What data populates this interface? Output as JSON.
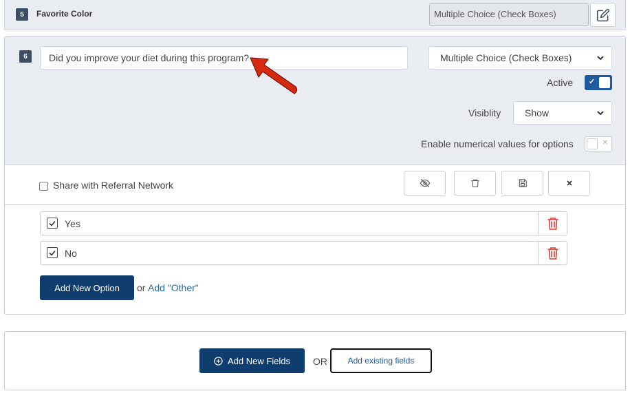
{
  "field5": {
    "number": "5",
    "title": "Favorite Color",
    "type_value": "Multiple Choice (Check Boxes)"
  },
  "field6": {
    "number": "6",
    "question_value": "Did you improve your diet during this program?",
    "type_value": "Multiple Choice (Check Boxes)",
    "active_label": "Active",
    "active_on": true,
    "visibility_label": "Visiblity",
    "visibility_value": "Show",
    "numerical_label": "Enable numerical values for options",
    "numerical_on": false,
    "share_label": "Share with Referral Network",
    "share_checked": false,
    "options": [
      {
        "label": "Yes",
        "checked": true
      },
      {
        "label": "No",
        "checked": true
      }
    ],
    "add_option_label": "Add New Option",
    "or_label": "or",
    "add_other_label": "Add \"Other\""
  },
  "footer": {
    "add_fields_label": "Add New Fields",
    "or_label": "OR",
    "add_existing_label": "Add existing fields"
  },
  "colors": {
    "primary_button": "#0f3e6e",
    "toggle_active": "#1f5a9e",
    "delete_icon": "#e53935",
    "annotation_arrow": "#d42a10"
  }
}
